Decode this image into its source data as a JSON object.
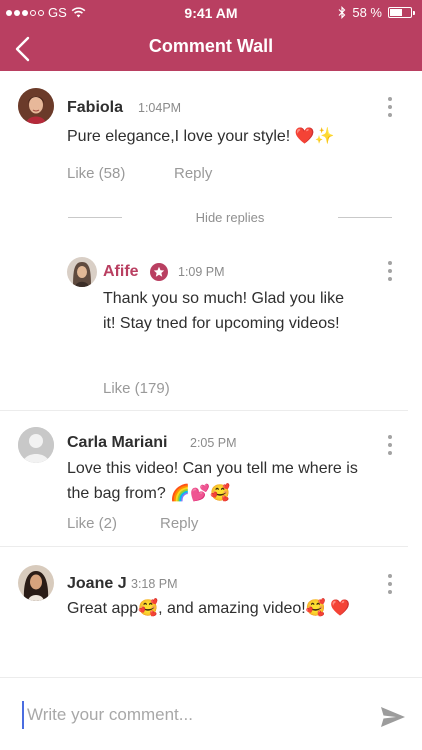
{
  "status_bar": {
    "carrier": "GS",
    "time": "9:41 AM",
    "battery": "58 %",
    "battery_level": 0.58
  },
  "header": {
    "title": "Comment Wall",
    "background_color": "#b93f61"
  },
  "comments": [
    {
      "author": "Fabiola",
      "time": "1:04PM",
      "text": "Pure elegance,I love your style! ❤️✨",
      "like_label": "Like (58)",
      "reply_label": "Reply",
      "hide_replies_label": "Hide replies",
      "avatar": "woman-avatar-dark-hair",
      "replies": [
        {
          "author": "Afife",
          "author_color": "#b93f61",
          "badge": "star-badge-icon",
          "time": "1:09 PM",
          "text_line1": "Thank you so much! Glad you like",
          "text_line2": "it! Stay tned for upcoming videos!",
          "like_label": "Like (179)",
          "avatar": "woman-avatar-headscarf"
        }
      ]
    },
    {
      "author": "Carla Mariani",
      "time": "2:05 PM",
      "text_line1": "Love this video! Can you tell me where is",
      "text_line2": "the bag from?  🌈💕🥰",
      "like_label": "Like (2)",
      "reply_label": "Reply",
      "avatar": "default-user-avatar"
    },
    {
      "author": "Joane J",
      "time": "3:18 PM",
      "text": "Great app🥰, and amazing video!🥰 ❤️",
      "avatar": "woman-avatar-long-hair"
    }
  ],
  "comment_input": {
    "placeholder": "Write your comment...",
    "value": ""
  }
}
